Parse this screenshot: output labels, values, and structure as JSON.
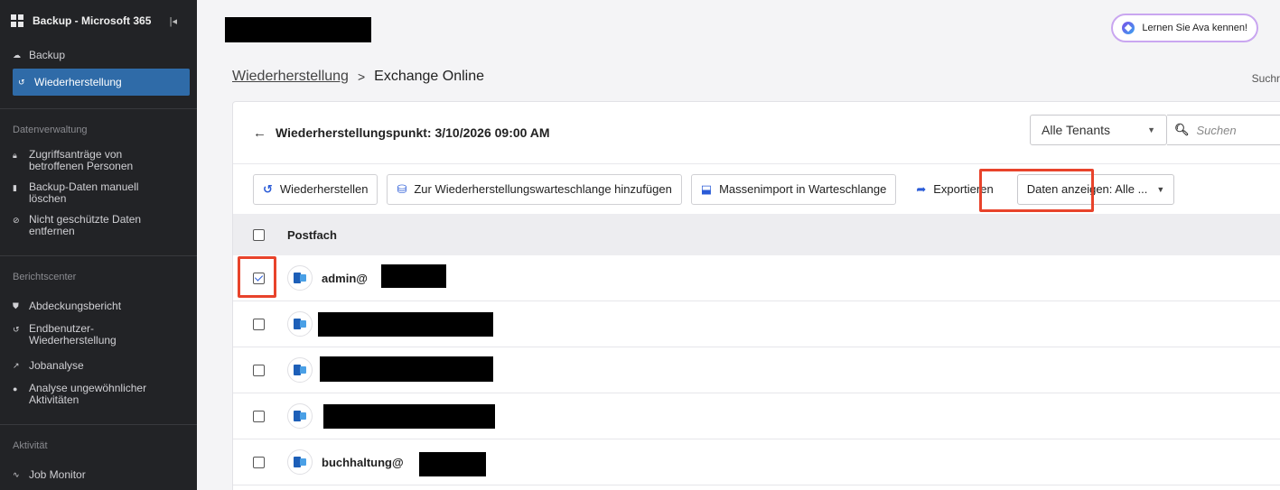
{
  "sidebar": {
    "title": "Backup - Microsoft 365",
    "collapse_icon": "collapse-icon",
    "items_top": [
      {
        "label": "Backup",
        "icon": "cloud-icon"
      },
      {
        "label": "Wiederherstellung",
        "icon": "restore-icon",
        "active": true
      }
    ],
    "section_data": "Datenverwaltung",
    "items_data": [
      {
        "label": "Zugriffsanträge von betroffenen Personen",
        "icon": "lock-icon"
      },
      {
        "label": "Backup-Daten manuell löschen",
        "icon": "trash-icon"
      },
      {
        "label": "Nicht geschützte Daten entfernen",
        "icon": "block-icon"
      }
    ],
    "section_reports": "Berichtscenter",
    "items_reports": [
      {
        "label": "Abdeckungsbericht",
        "icon": "shield-icon"
      },
      {
        "label": "Endbenutzer-Wiederherstellung",
        "icon": "restore-icon"
      },
      {
        "label": "Jobanalyse",
        "icon": "chart-icon"
      },
      {
        "label": "Analyse ungewöhnlicher Aktivitäten",
        "icon": "alert-icon"
      }
    ],
    "section_activity": "Aktivität",
    "items_activity": [
      {
        "label": "Job Monitor",
        "icon": "monitor-icon"
      }
    ]
  },
  "header": {
    "ava_label": "Lernen Sie Ava kennen!",
    "breadcrumb_link": "Wiederherstellung",
    "breadcrumb_sep": ">",
    "breadcrumb_current": "Exchange Online",
    "top_search_label": "Suchr"
  },
  "panel": {
    "back_arrow": "←",
    "title": "Wiederherstellungspunkt: 3/10/2026 09:00 AM",
    "tenant_select_value": "Alle Tenants",
    "search_placeholder": "Suchen"
  },
  "toolbar": {
    "restore_label": "Wiederherstellen",
    "add_queue_label": "Zur Wiederherstellungswarteschlange hinzufügen",
    "bulk_import_label": "Massenimport in Warteschlange",
    "export_label": "Exportieren",
    "view_data_label": "Daten anzeigen: Alle ..."
  },
  "table": {
    "column_header": "Postfach",
    "rows": [
      {
        "name": "admin@",
        "checked": true
      },
      {
        "name": "",
        "checked": false
      },
      {
        "name": "",
        "checked": false
      },
      {
        "name": "",
        "checked": false
      },
      {
        "name": "buchhaltung@",
        "checked": false
      }
    ]
  },
  "colors": {
    "sidebar_bg": "#222326",
    "active_item": "#2f6ba8",
    "accent_blue": "#2a5bd7",
    "highlight_red": "#e8432b"
  }
}
